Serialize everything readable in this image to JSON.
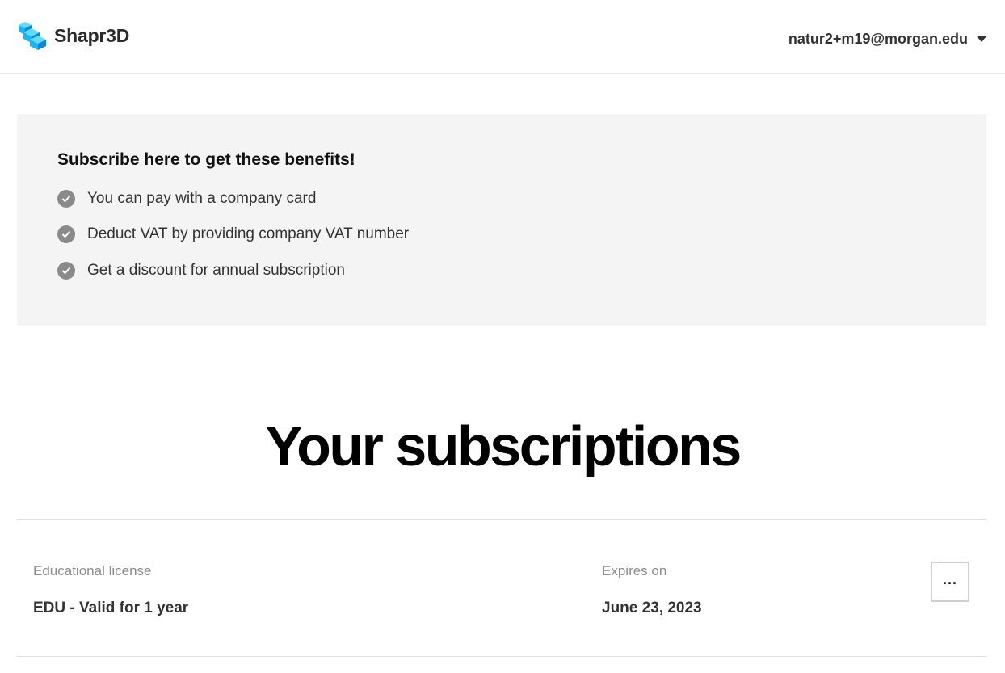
{
  "header": {
    "logo_text": "Shapr3D",
    "account_email": "natur2+m19@morgan.edu"
  },
  "benefits": {
    "title": "Subscribe here to get these benefits!",
    "items": [
      "You can pay with a company card",
      "Deduct VAT by providing company VAT number",
      "Get a discount for annual subscription"
    ]
  },
  "subscriptions": {
    "title": "Your subscriptions",
    "rows": [
      {
        "type_label": "Educational license",
        "type_value": "EDU - Valid for 1 year",
        "expiry_label": "Expires on",
        "expiry_value": "June 23, 2023",
        "more_label": "..."
      }
    ]
  },
  "colors": {
    "logo_light": "#3fd3ff",
    "logo_mid": "#1bb4f2",
    "logo_dark": "#0b86d9",
    "check": "#8a8a8a",
    "panel_bg": "#f4f4f4"
  },
  "icons": [
    "shapr3d-logo-icon",
    "chevron-down-icon",
    "check-circle-icon"
  ]
}
